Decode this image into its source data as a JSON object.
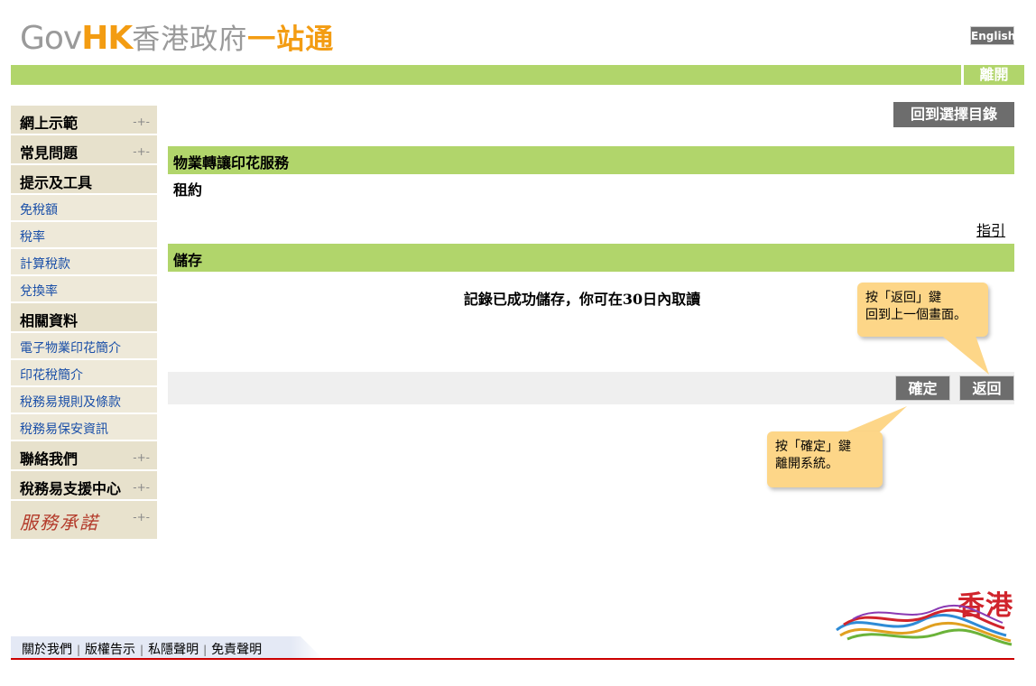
{
  "header": {
    "logo_gov": "Gov",
    "logo_hk": "HK",
    "logo_zh": "香港政府",
    "logo_one": "一站通",
    "english_label": "English",
    "exit_label": "離開"
  },
  "sidebar": {
    "items": [
      {
        "label": "網上示範",
        "type": "head",
        "arrow": true
      },
      {
        "label": "常見問題",
        "type": "head",
        "arrow": true
      },
      {
        "label": "提示及工具",
        "type": "head",
        "arrow": false
      },
      {
        "label": "免稅額",
        "type": "sub"
      },
      {
        "label": "稅率",
        "type": "sub"
      },
      {
        "label": "計算稅款",
        "type": "sub"
      },
      {
        "label": "兌換率",
        "type": "sub"
      },
      {
        "label": "相關資料",
        "type": "head",
        "arrow": false
      },
      {
        "label": "電子物業印花簡介",
        "type": "sub"
      },
      {
        "label": "印花稅簡介",
        "type": "sub"
      },
      {
        "label": "稅務易規則及條款",
        "type": "sub"
      },
      {
        "label": "稅務易保安資訊",
        "type": "sub"
      },
      {
        "label": "聯絡我們",
        "type": "head",
        "arrow": true
      },
      {
        "label": "稅務易支援中心",
        "type": "head",
        "arrow": true
      },
      {
        "label": "服務承諾",
        "type": "promise",
        "arrow": true
      }
    ],
    "arrow_glyph": "-+-"
  },
  "main": {
    "back_to_list_label": "回到選擇目錄",
    "service_title": "物業轉讓印花服務",
    "document_type": "租約",
    "guide_link": "指引",
    "save_section_title": "儲存",
    "save_message": "記錄已成功儲存，你可在30日內取讀",
    "confirm_label": "確定",
    "back_label": "返回"
  },
  "tooltips": {
    "back_tip_line1": "按「返回」鍵",
    "back_tip_line2": "回到上一個畫面。",
    "confirm_tip_line1": "按「確定」鍵",
    "confirm_tip_line2": "離開系統。"
  },
  "footer": {
    "links": [
      "關於我們",
      "版權告示",
      "私隱聲明",
      "免責聲明"
    ],
    "separator": "|",
    "brand_text": "香港"
  },
  "colors": {
    "accent_green": "#b1d56b",
    "button_grey": "#6d6d6d",
    "tooltip_yellow": "#fdd688",
    "logo_orange": "#f39c12",
    "footer_red": "#cc0000"
  }
}
